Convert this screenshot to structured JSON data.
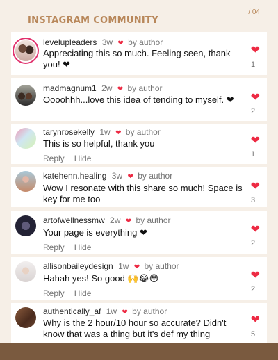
{
  "header": {
    "title": "INSTAGRAM COMMUNITY",
    "page": "/ 04"
  },
  "comments": [
    {
      "user": "levelupleaders",
      "time": "3w",
      "by": "by author",
      "text": "Appreciating this so much. Feeling seen, thank you! ❤",
      "likes": "1",
      "reply": "",
      "hide": ""
    },
    {
      "user": "madmagnum1",
      "time": "2w",
      "by": "by author",
      "text": "Oooohhh...love this idea of tending to myself. ❤",
      "likes": "2",
      "reply": "",
      "hide": ""
    },
    {
      "user": "tarynrosekelly",
      "time": "1w",
      "by": "by author",
      "text": "This is so helpful, thank you",
      "likes": "1",
      "reply": "Reply",
      "hide": "Hide"
    },
    {
      "user": "katehenn.healing",
      "time": "3w",
      "by": "by author",
      "text": "Wow I resonate with this share so much! Space is key for me too",
      "likes": "3",
      "reply": "",
      "hide": ""
    },
    {
      "user": "artofwellnessmw",
      "time": "2w",
      "by": "by author",
      "text": "Your page is everything ❤",
      "likes": "2",
      "reply": "Reply",
      "hide": "Hide"
    },
    {
      "user": "allisonbaileydesign",
      "time": "1w",
      "by": "by author",
      "text": "Hahah yes! So good 🙌😂😳",
      "likes": "2",
      "reply": "Reply",
      "hide": "Hide"
    },
    {
      "user": "authentically_af",
      "time": "1w",
      "by": "by author",
      "text": "Why is the 2 hour/10 hour so accurate? Didn't know that was a thing but it's def my thing",
      "likes": "5",
      "reply": "",
      "hide": ""
    }
  ],
  "icons": {
    "like": "heart-icon"
  },
  "colors": {
    "accent": "#b8875a",
    "heart": "#ed2a43",
    "footer": "#7a5a3f"
  }
}
